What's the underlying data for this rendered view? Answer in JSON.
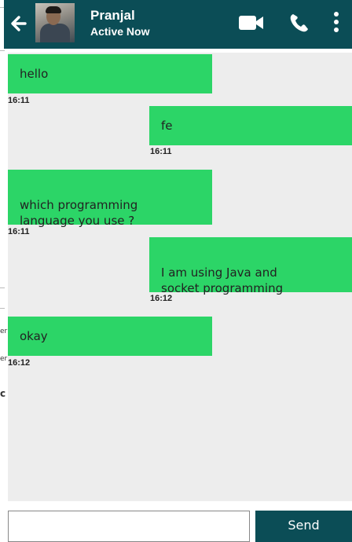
{
  "header": {
    "contact_name": "Pranjal",
    "contact_status": "Active Now"
  },
  "messages": [
    {
      "direction": "in",
      "text": "hello",
      "time": "16:11"
    },
    {
      "direction": "out",
      "text": "fe",
      "time": "16:11"
    },
    {
      "direction": "in",
      "text": "which programming\nlanguage you use ?",
      "time": "16:11"
    },
    {
      "direction": "out",
      "text": "I am using Java and\nsocket programming",
      "time": "16:12"
    },
    {
      "direction": "in",
      "text": "okay",
      "time": "16:12"
    }
  ],
  "composer": {
    "input_value": "",
    "send_label": "Send"
  },
  "background_marks": [
    "er",
    "er",
    "c"
  ],
  "colors": {
    "header": "#0b4d56",
    "bubble": "#2cd567",
    "chat_background": "#ededed"
  },
  "icons": [
    "back-arrow-icon",
    "video-camera-icon",
    "phone-icon",
    "more-vertical-icon"
  ]
}
